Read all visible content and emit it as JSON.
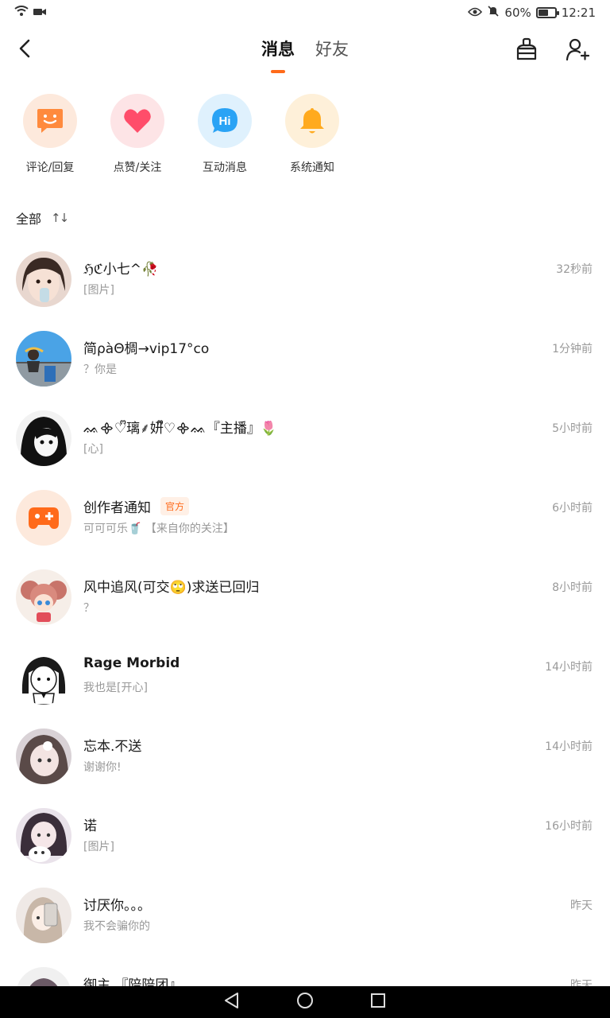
{
  "status_bar": {
    "battery_pct": "60%",
    "battery_level": 0.6,
    "time": "12:21"
  },
  "header": {
    "tabs": [
      {
        "label": "消息",
        "active": true
      },
      {
        "label": "好友",
        "active": false
      }
    ],
    "icons": [
      "back-icon",
      "clean-icon",
      "add-friend-icon"
    ]
  },
  "categories": [
    {
      "label": "评论/回复",
      "icon": "comment-icon",
      "bg": "#fde9dc",
      "color": "#ff8a3d"
    },
    {
      "label": "点赞/关注",
      "icon": "heart-icon",
      "bg": "#fde4e6",
      "color": "#ff4d6a"
    },
    {
      "label": "互动消息",
      "icon": "hi-icon",
      "bg": "#dff1fd",
      "color": "#2aa3f5"
    },
    {
      "label": "系统通知",
      "icon": "bell-icon",
      "bg": "#fef0d9",
      "color": "#ffaa1e"
    }
  ],
  "sort": {
    "label": "全部",
    "icon_text": "↑↓"
  },
  "messages": [
    {
      "name": "ℌℭ小七^🥀",
      "preview": "[图片]",
      "time": "32秒前"
    },
    {
      "name": "简ρàΘ椆→vip17°co",
      "preview": "？你是",
      "time": "1分钟前"
    },
    {
      "name": "ᨐ᯽♡ᩚ璃⸙妍ᩚ♡᯽ᨐ『主播』🌷",
      "preview": "[心]",
      "time": "5小时前"
    },
    {
      "name": "创作者通知",
      "badge": "官方",
      "preview": "可可可乐🥤 【来自你的关注】",
      "time": "6小时前",
      "official": true
    },
    {
      "name": "风中追风(可交🙄)求送已回归",
      "preview": "？",
      "time": "8小时前"
    },
    {
      "name": "Rage Morbid",
      "preview": "我也是[开心]",
      "time": "14小时前"
    },
    {
      "name": "忘本.不送",
      "preview": "谢谢你!",
      "time": "14小时前"
    },
    {
      "name": "诺",
      "preview": "[图片]",
      "time": "16小时前"
    },
    {
      "name": "讨厌你。。。",
      "preview": "我不会骗你的",
      "time": "昨天"
    },
    {
      "name": "御主.『陪陪团』",
      "preview": "",
      "time": "昨天"
    }
  ]
}
